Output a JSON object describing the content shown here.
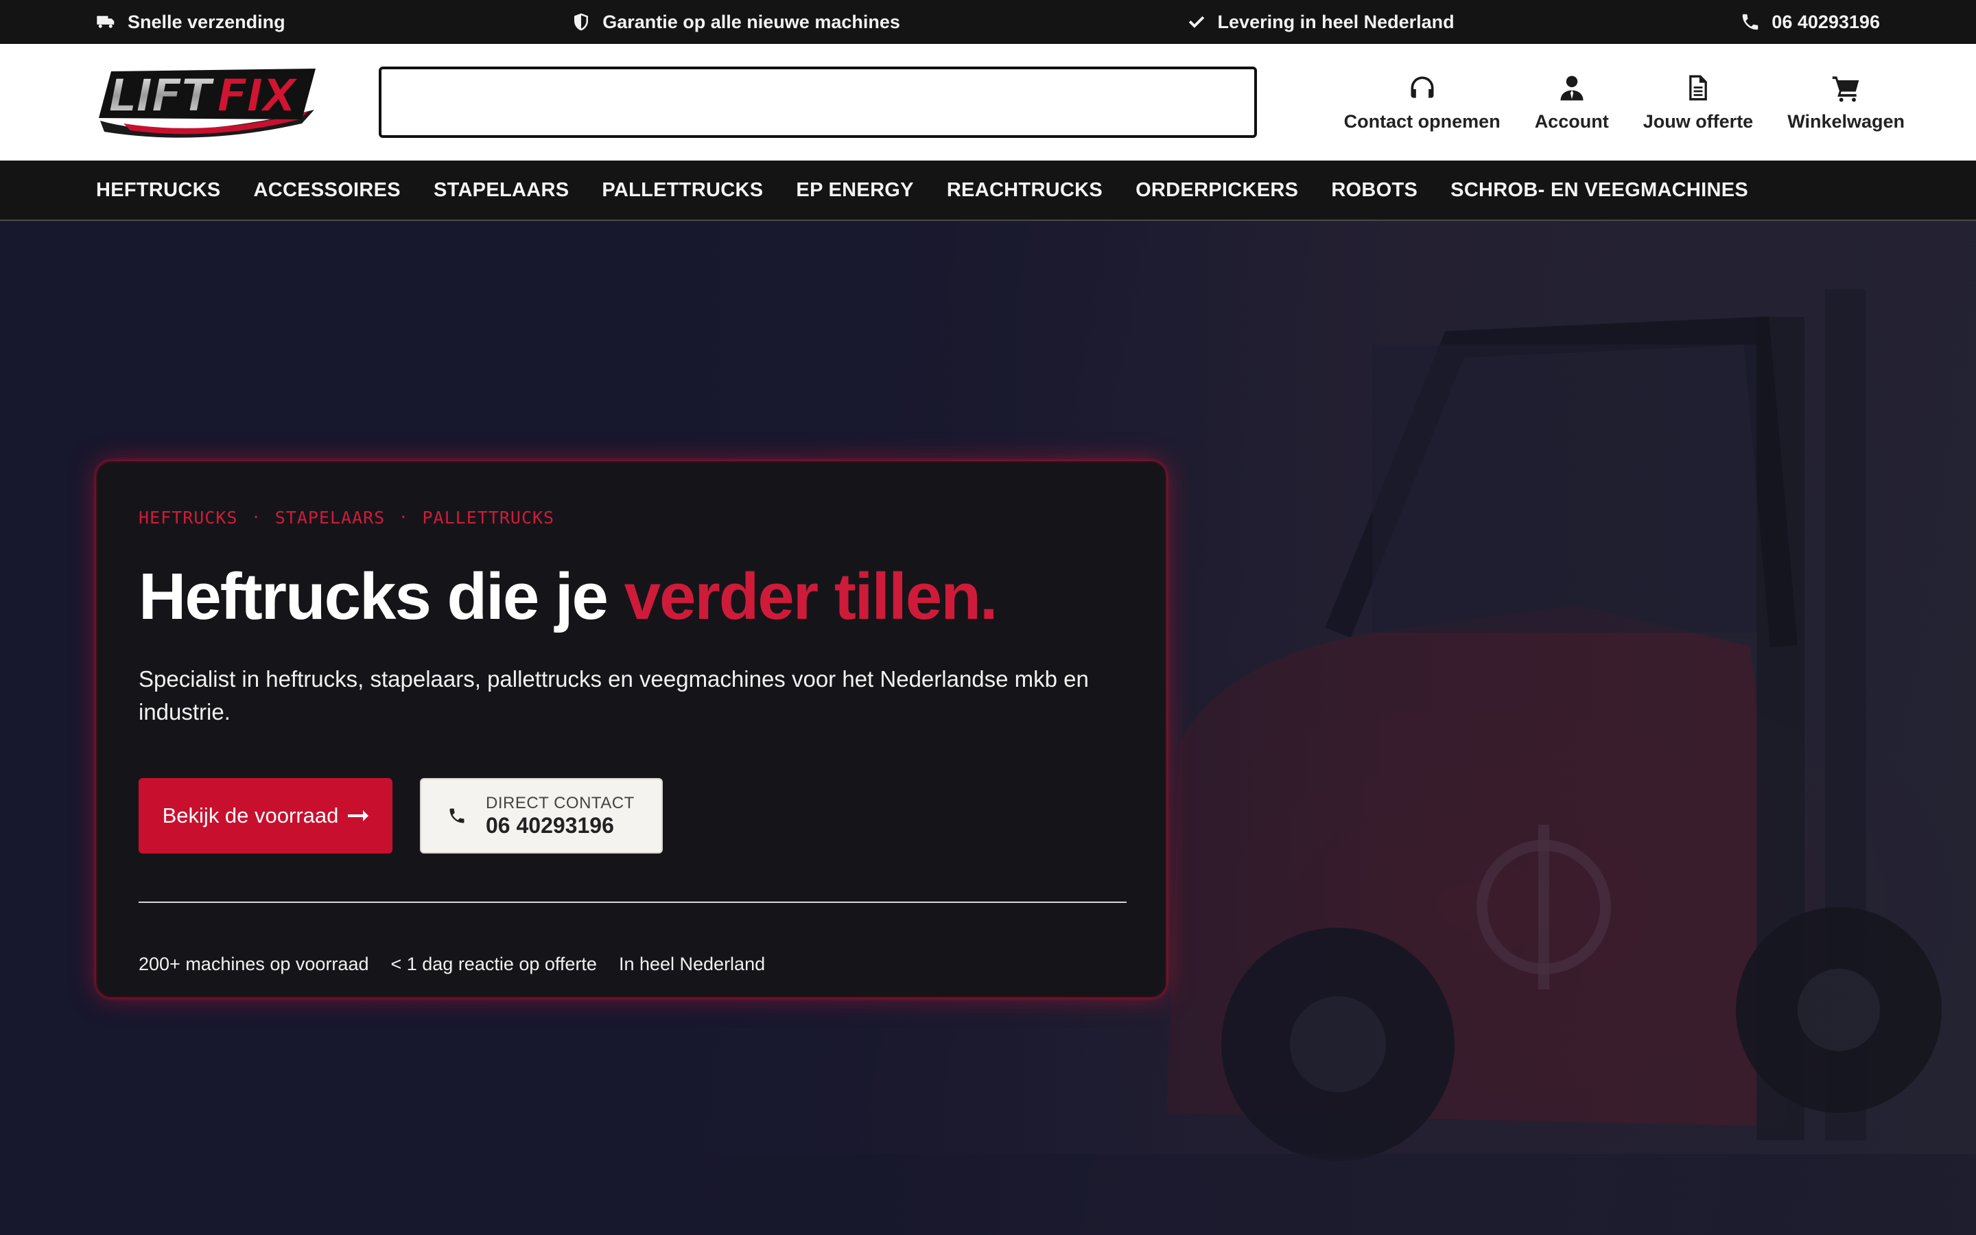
{
  "topbar": {
    "items": [
      {
        "icon": "truck-icon",
        "label": "Snelle verzending"
      },
      {
        "icon": "shield-icon",
        "label": "Garantie op alle nieuwe machines"
      },
      {
        "icon": "check-icon",
        "label": "Levering in heel Nederland"
      },
      {
        "icon": "phone-icon",
        "label": "06 40293196"
      }
    ]
  },
  "header": {
    "logo_text": "LIFTFIX",
    "search": {
      "value": "",
      "placeholder": ""
    },
    "actions": [
      {
        "icon": "headset-icon",
        "label": "Contact opnemen"
      },
      {
        "icon": "user-icon",
        "label": "Account"
      },
      {
        "icon": "document-icon",
        "label": "Jouw offerte"
      },
      {
        "icon": "cart-icon",
        "label": "Winkelwagen"
      }
    ]
  },
  "nav": {
    "items": [
      "HEFTRUCKS",
      "ACCESSOIRES",
      "STAPELAARS",
      "PALLETTRUCKS",
      "EP ENERGY",
      "REACHTRUCKS",
      "ORDERPICKERS",
      "ROBOTS",
      "SCHROB- EN VEEGMACHINES"
    ]
  },
  "hero": {
    "crumbs": [
      "HEFTRUCKS",
      "STAPELAARS",
      "PALLETTRUCKS"
    ],
    "crumb_separator": "·",
    "headline_main": "Heftrucks die je ",
    "headline_accent": "verder tillen.",
    "subtitle": "Specialist in heftrucks, stapelaars, pallettrucks en veegmachines voor het Nederlandse mkb en industrie.",
    "primary_button": "Bekijk de voorraad",
    "contact_label": "DIRECT CONTACT",
    "contact_number": "06 40293196",
    "stats": [
      "200+ machines op voorraad",
      "< 1 dag reactie op offerte",
      "In heel Nederland"
    ]
  },
  "colors": {
    "accent": "#c8102e",
    "dark": "#141414",
    "hero_bg": "#17172d"
  }
}
